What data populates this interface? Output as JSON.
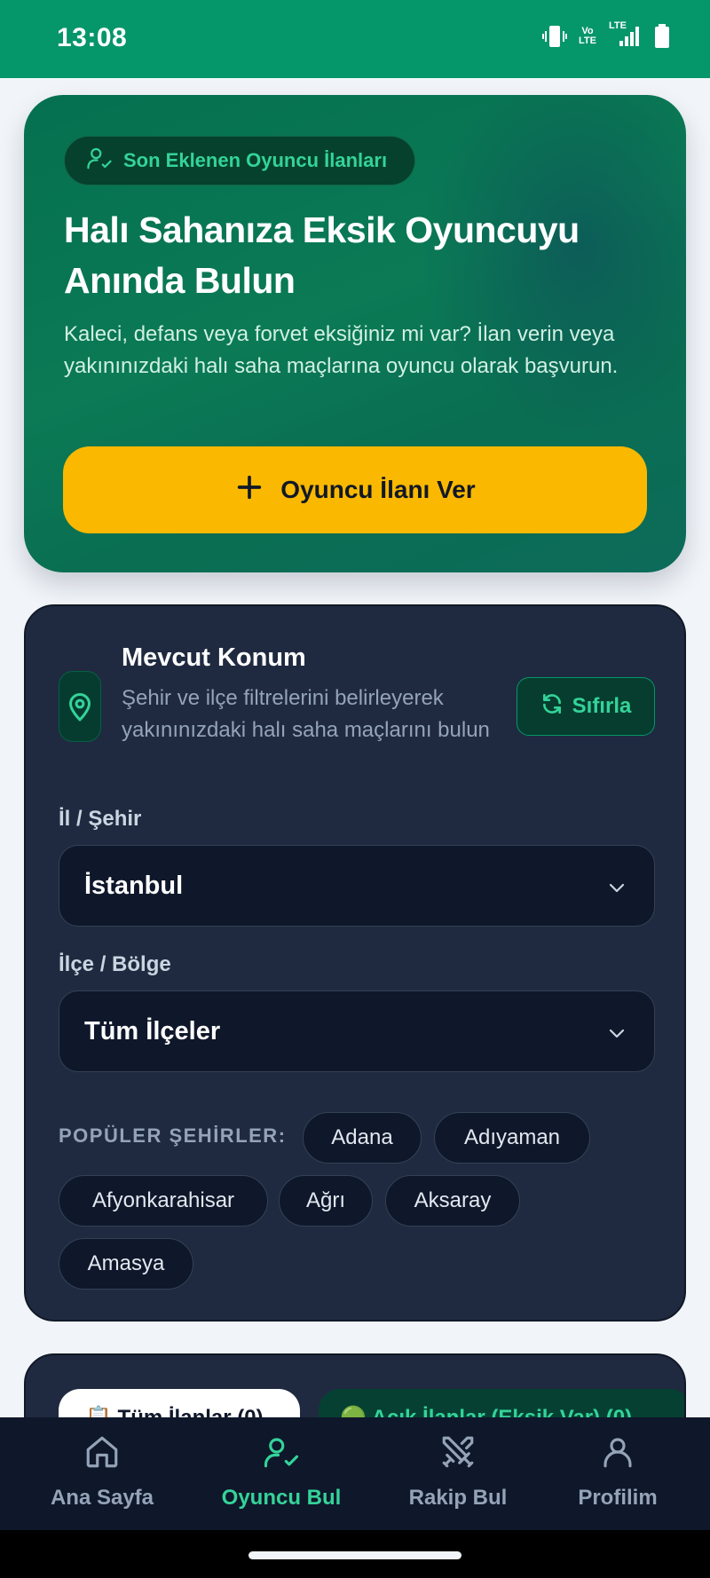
{
  "status_bar": {
    "time": "13:08",
    "volte_top": "Vo",
    "volte_bottom": "LTE",
    "lte_label": "LTE"
  },
  "hero": {
    "badge_label": "Son Eklenen Oyuncu İlanları",
    "title": "Halı Sahanıza Eksik Oyuncuyu Anında Bulun",
    "description": "Kaleci, defans veya forvet eksiğiniz mi var? İlan verin veya yakınınızdaki halı saha maçlarına oyuncu olarak başvurun.",
    "cta_label": "Oyuncu İlanı Ver"
  },
  "location": {
    "title": "Mevcut Konum",
    "description": "Şehir ve ilçe filtrelerini belirleyerek yakınınızdaki halı saha maçlarını bulun",
    "reset_label": "Sıfırla"
  },
  "filters": {
    "city_label": "İl / Şehir",
    "city_value": "İstanbul",
    "district_label": "İlçe / Bölge",
    "district_value": "Tüm İlçeler",
    "popular_label": "POPÜLER ŞEHİRLER:",
    "popular_cities": [
      "Adana",
      "Adıyaman",
      "Afyonkarahisar",
      "Ağrı",
      "Aksaray",
      "Amasya"
    ]
  },
  "listing_tabs": {
    "all_label": "📋 Tüm İlanlar (0)",
    "open_label": "🟢 Açık İlanlar (Eksik Var) (0)"
  },
  "bottom_nav": {
    "items": [
      {
        "label": "Ana Sayfa",
        "icon": "home-icon"
      },
      {
        "label": "Oyuncu Bul",
        "icon": "user-check-icon"
      },
      {
        "label": "Rakip Bul",
        "icon": "swords-icon"
      },
      {
        "label": "Profilim",
        "icon": "user-icon"
      }
    ],
    "active_index": 1
  },
  "colors": {
    "status_bar": "#05966a",
    "hero_green": "#0b7a55",
    "cta_yellow": "#fbb800",
    "card_dark": "#1f2a40",
    "accent_green": "#34d399",
    "nav_bg": "#0f172a"
  }
}
